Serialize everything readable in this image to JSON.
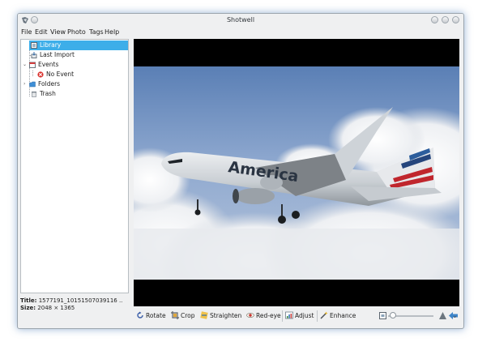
{
  "window": {
    "title": "Shotwell"
  },
  "menu": [
    "File",
    "Edit",
    "View",
    "Photo",
    "Tags",
    "Help"
  ],
  "sidebar": {
    "items": [
      {
        "label": "Library",
        "selected": true
      },
      {
        "label": "Last Import"
      },
      {
        "label": "Events"
      },
      {
        "label": "No Event"
      },
      {
        "label": "Folders"
      },
      {
        "label": "Trash"
      }
    ]
  },
  "info": {
    "title_label": "Title:",
    "title_value": "1577191_10151507039116 ..",
    "size_label": "Size:",
    "size_value": "2048 × 1365"
  },
  "photo": {
    "fuselage_text": "America"
  },
  "toolbar": {
    "rotate": "Rotate",
    "crop": "Crop",
    "straighten": "Straighten",
    "redeye": "Red-eye",
    "adjust": "Adjust",
    "enhance": "Enhance"
  },
  "zoom": {
    "level": 0.05
  },
  "colors": {
    "selection": "#3daee9",
    "window_bg": "#eff0f1"
  }
}
